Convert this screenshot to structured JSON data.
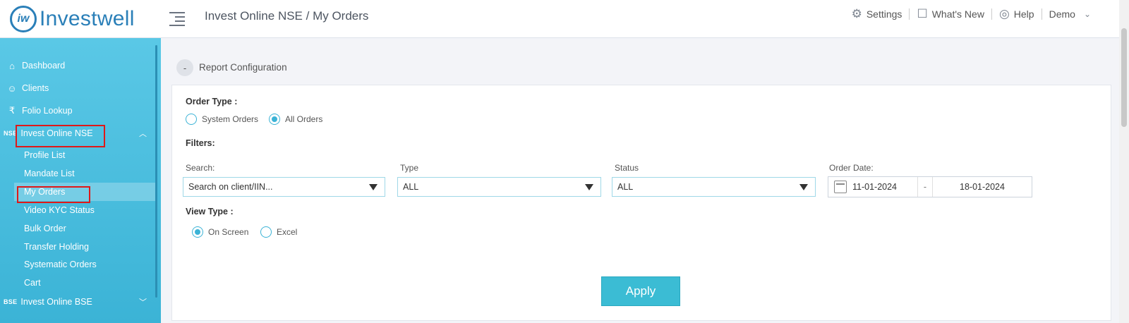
{
  "header": {
    "logo_mark": "iw",
    "logo_text": "Investwell",
    "page_title": "Invest Online NSE / My Orders",
    "settings": "Settings",
    "whats_new": "What's New",
    "help": "Help",
    "user": "Demo"
  },
  "sidebar": {
    "items": [
      {
        "label": "Dashboard",
        "icon": "home-icon"
      },
      {
        "label": "Clients",
        "icon": "users-icon"
      },
      {
        "label": "Folio Lookup",
        "icon": "folio-icon"
      },
      {
        "label": "Invest Online NSE",
        "tag": "NSE",
        "expanded": true
      },
      {
        "label": "Profile List"
      },
      {
        "label": "Mandate List"
      },
      {
        "label": "My Orders",
        "active": true
      },
      {
        "label": "Video KYC Status"
      },
      {
        "label": "Bulk Order"
      },
      {
        "label": "Transfer Holding"
      },
      {
        "label": "Systematic Orders"
      },
      {
        "label": "Cart"
      },
      {
        "label": "Invest Online BSE",
        "tag": "BSE",
        "expanded": false
      }
    ]
  },
  "report": {
    "toggle_symbol": "-",
    "title": "Report Configuration",
    "order_type_label": "Order Type :",
    "order_types": [
      "System Orders",
      "All Orders"
    ],
    "order_type_selected": "All Orders",
    "filters_label": "Filters:",
    "search_label": "Search:",
    "search_value": "Search on client/IIN...",
    "type_label": "Type",
    "type_value": "ALL",
    "status_label": "Status",
    "status_value": "ALL",
    "order_date_label": "Order Date:",
    "date_from": "11-01-2024",
    "date_sep": "-",
    "date_to": "18-01-2024",
    "view_type_label": "View Type :",
    "view_types": [
      "On Screen",
      "Excel"
    ],
    "view_type_selected": "On Screen",
    "apply_label": "Apply"
  },
  "colors": {
    "accent": "#3bb3d6",
    "sidebar": "#4dbfe0",
    "highlight_box": "#e01818"
  }
}
